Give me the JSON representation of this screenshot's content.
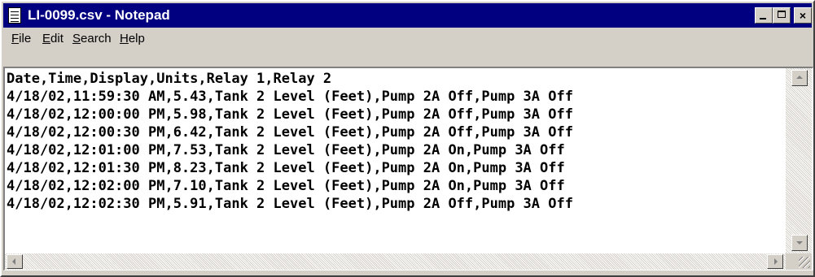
{
  "window": {
    "title": "LI-0099.csv - Notepad",
    "controls": {
      "minimize": "",
      "maximize": "",
      "close": "×"
    }
  },
  "menu": [
    {
      "key": "F",
      "rest": "ile"
    },
    {
      "key": "E",
      "rest": "dit"
    },
    {
      "key": "S",
      "rest": "earch"
    },
    {
      "key": "H",
      "rest": "elp"
    }
  ],
  "document": {
    "lines": [
      "Date,Time,Display,Units,Relay 1,Relay 2",
      "4/18/02,11:59:30 AM,5.43,Tank 2 Level (Feet),Pump 2A Off,Pump 3A Off",
      "4/18/02,12:00:00 PM,5.98,Tank 2 Level (Feet),Pump 2A Off,Pump 3A Off",
      "4/18/02,12:00:30 PM,6.42,Tank 2 Level (Feet),Pump 2A Off,Pump 3A Off",
      "4/18/02,12:01:00 PM,7.53,Tank 2 Level (Feet),Pump 2A On,Pump 3A Off",
      "4/18/02,12:01:30 PM,8.23,Tank 2 Level (Feet),Pump 2A On,Pump 3A Off",
      "4/18/02,12:02:00 PM,7.10,Tank 2 Level (Feet),Pump 2A On,Pump 3A Off",
      "4/18/02,12:02:30 PM,5.91,Tank 2 Level (Feet),Pump 2A Off,Pump 3A Off"
    ]
  },
  "icons": {
    "app": "notepad-icon",
    "scroll_up": "arrow-up-icon",
    "scroll_down": "arrow-down-icon",
    "scroll_left": "arrow-left-icon",
    "scroll_right": "arrow-right-icon",
    "resize": "size-grip-icon"
  },
  "colors": {
    "titlebar": "#000080",
    "chrome": "#d4d0c8",
    "editor_bg": "#ffffff"
  }
}
